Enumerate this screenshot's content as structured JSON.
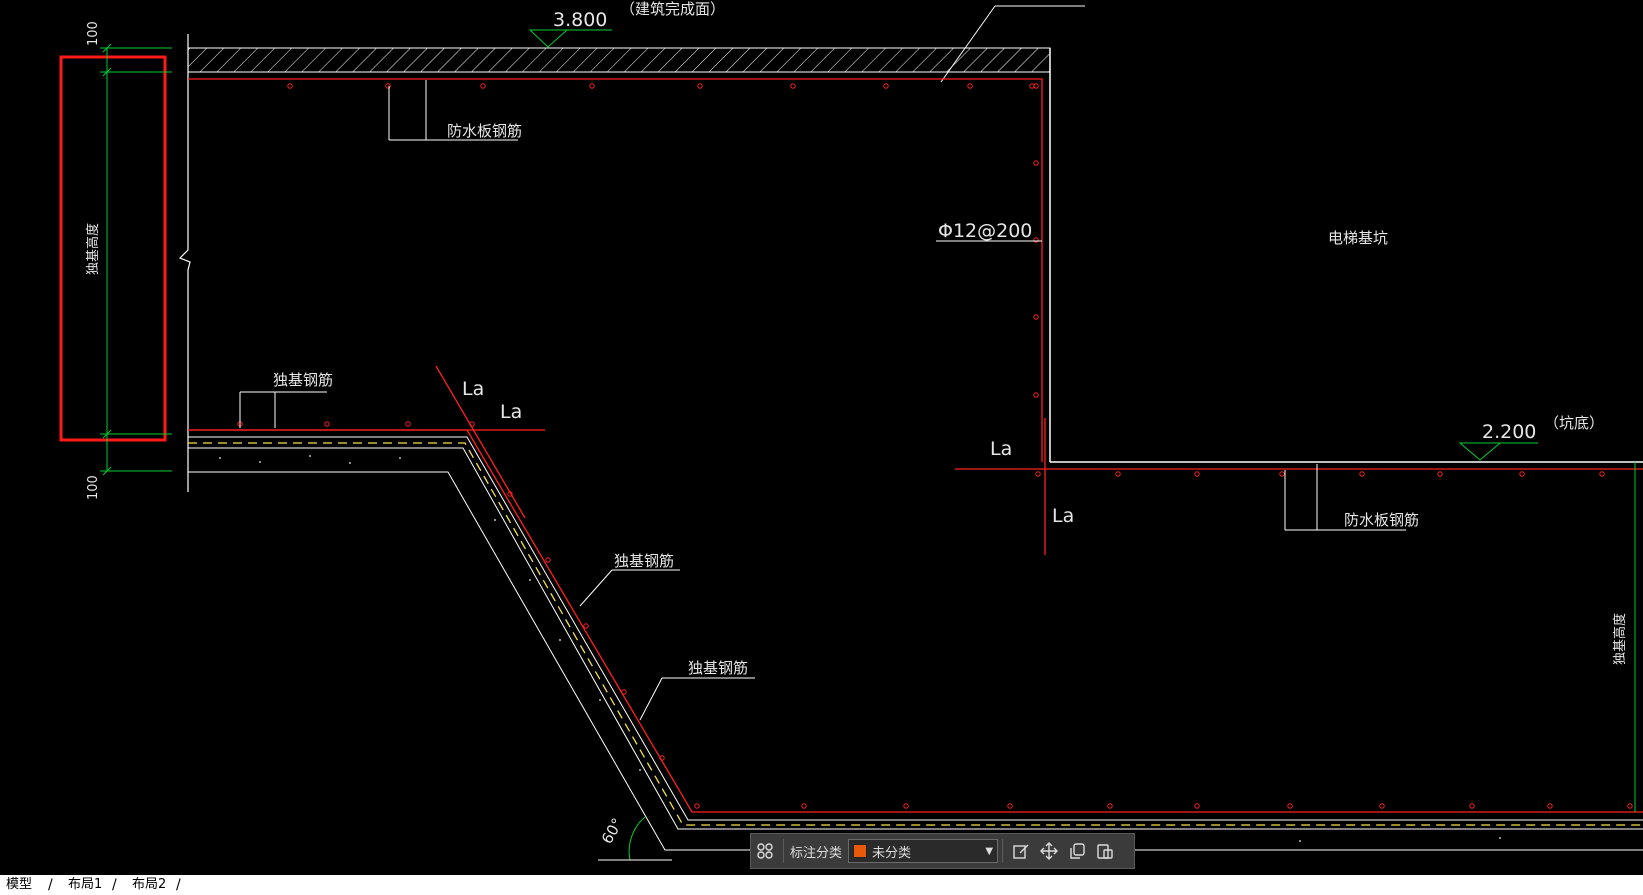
{
  "drawing": {
    "elevation_top": "3.800",
    "elevation_top_note": "（建筑完成面）",
    "elevation_pit": "2.200",
    "elevation_pit_note": "（坑底）",
    "rebar_spec": "Φ12@200",
    "label_waterproof_rebar": "防水板钢筋",
    "label_waterproof_rebar_2": "防水板钢筋",
    "label_pile_rebar_1": "独基钢筋",
    "label_pile_rebar_2": "独基钢筋",
    "label_pile_rebar_3": "独基钢筋",
    "label_pile_height_left": "独基高度",
    "label_pile_height_right": "独基高度",
    "label_elevator_pit": "电梯基坑",
    "anchor_la_1": "La",
    "anchor_la_2": "La",
    "anchor_la_3": "La",
    "anchor_la_4": "La",
    "dim_100_top": "100",
    "dim_100_bottom": "100",
    "angle": "60°",
    "colors": {
      "rebar": "#ff2020",
      "dimension": "#00cc33",
      "linework": "#ffffff",
      "hidden": "#f5e04a",
      "highlight": "#ff1a1a"
    }
  },
  "annotation_toolbar": {
    "label": "标注分类",
    "selected": "未分类",
    "swatch_color": "#e8590c",
    "icons": [
      "category-grid-icon",
      "edit-icon",
      "move-icon",
      "copy-icon",
      "paste-icon"
    ]
  },
  "layout_tabs": [
    "模型",
    "布局1",
    "布局2"
  ]
}
